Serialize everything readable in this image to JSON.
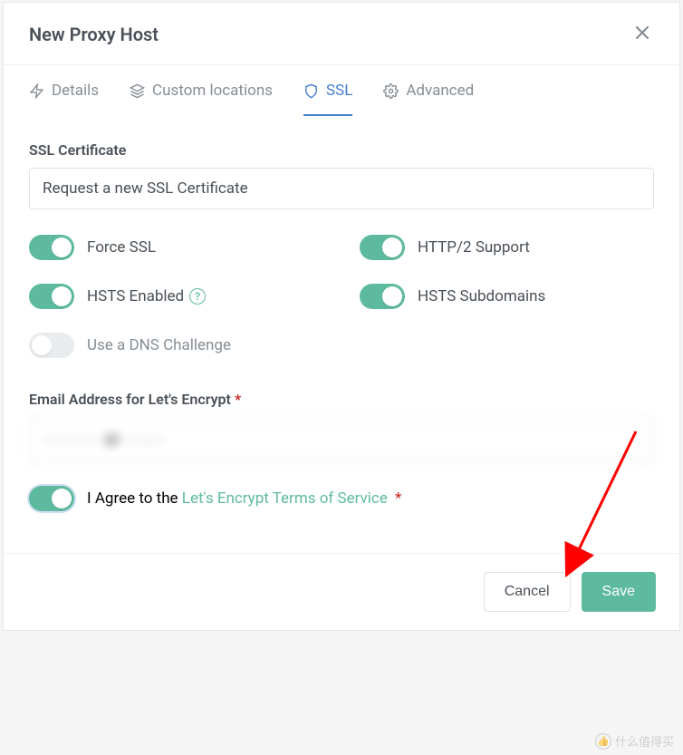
{
  "modal": {
    "title": "New Proxy Host"
  },
  "tabs": {
    "details": "Details",
    "custom_locations": "Custom locations",
    "ssl": "SSL",
    "advanced": "Advanced"
  },
  "ssl": {
    "cert_label": "SSL Certificate",
    "cert_value": "Request a new SSL Certificate",
    "force_ssl": {
      "label": "Force SSL",
      "on": true
    },
    "http2": {
      "label": "HTTP/2 Support",
      "on": true
    },
    "hsts": {
      "label": "HSTS Enabled",
      "on": true
    },
    "hsts_sub": {
      "label": "HSTS Subdomains",
      "on": true
    },
    "dns_challenge": {
      "label": "Use a DNS Challenge",
      "on": false
    },
    "email_label": "Email Address for Let's Encrypt",
    "email_value": "············@·····.···",
    "agree_prefix": "I Agree to the ",
    "agree_link": "Let's Encrypt Terms of Service",
    "agree_on": true
  },
  "footer": {
    "cancel": "Cancel",
    "save": "Save"
  },
  "watermark": "什么值得买"
}
